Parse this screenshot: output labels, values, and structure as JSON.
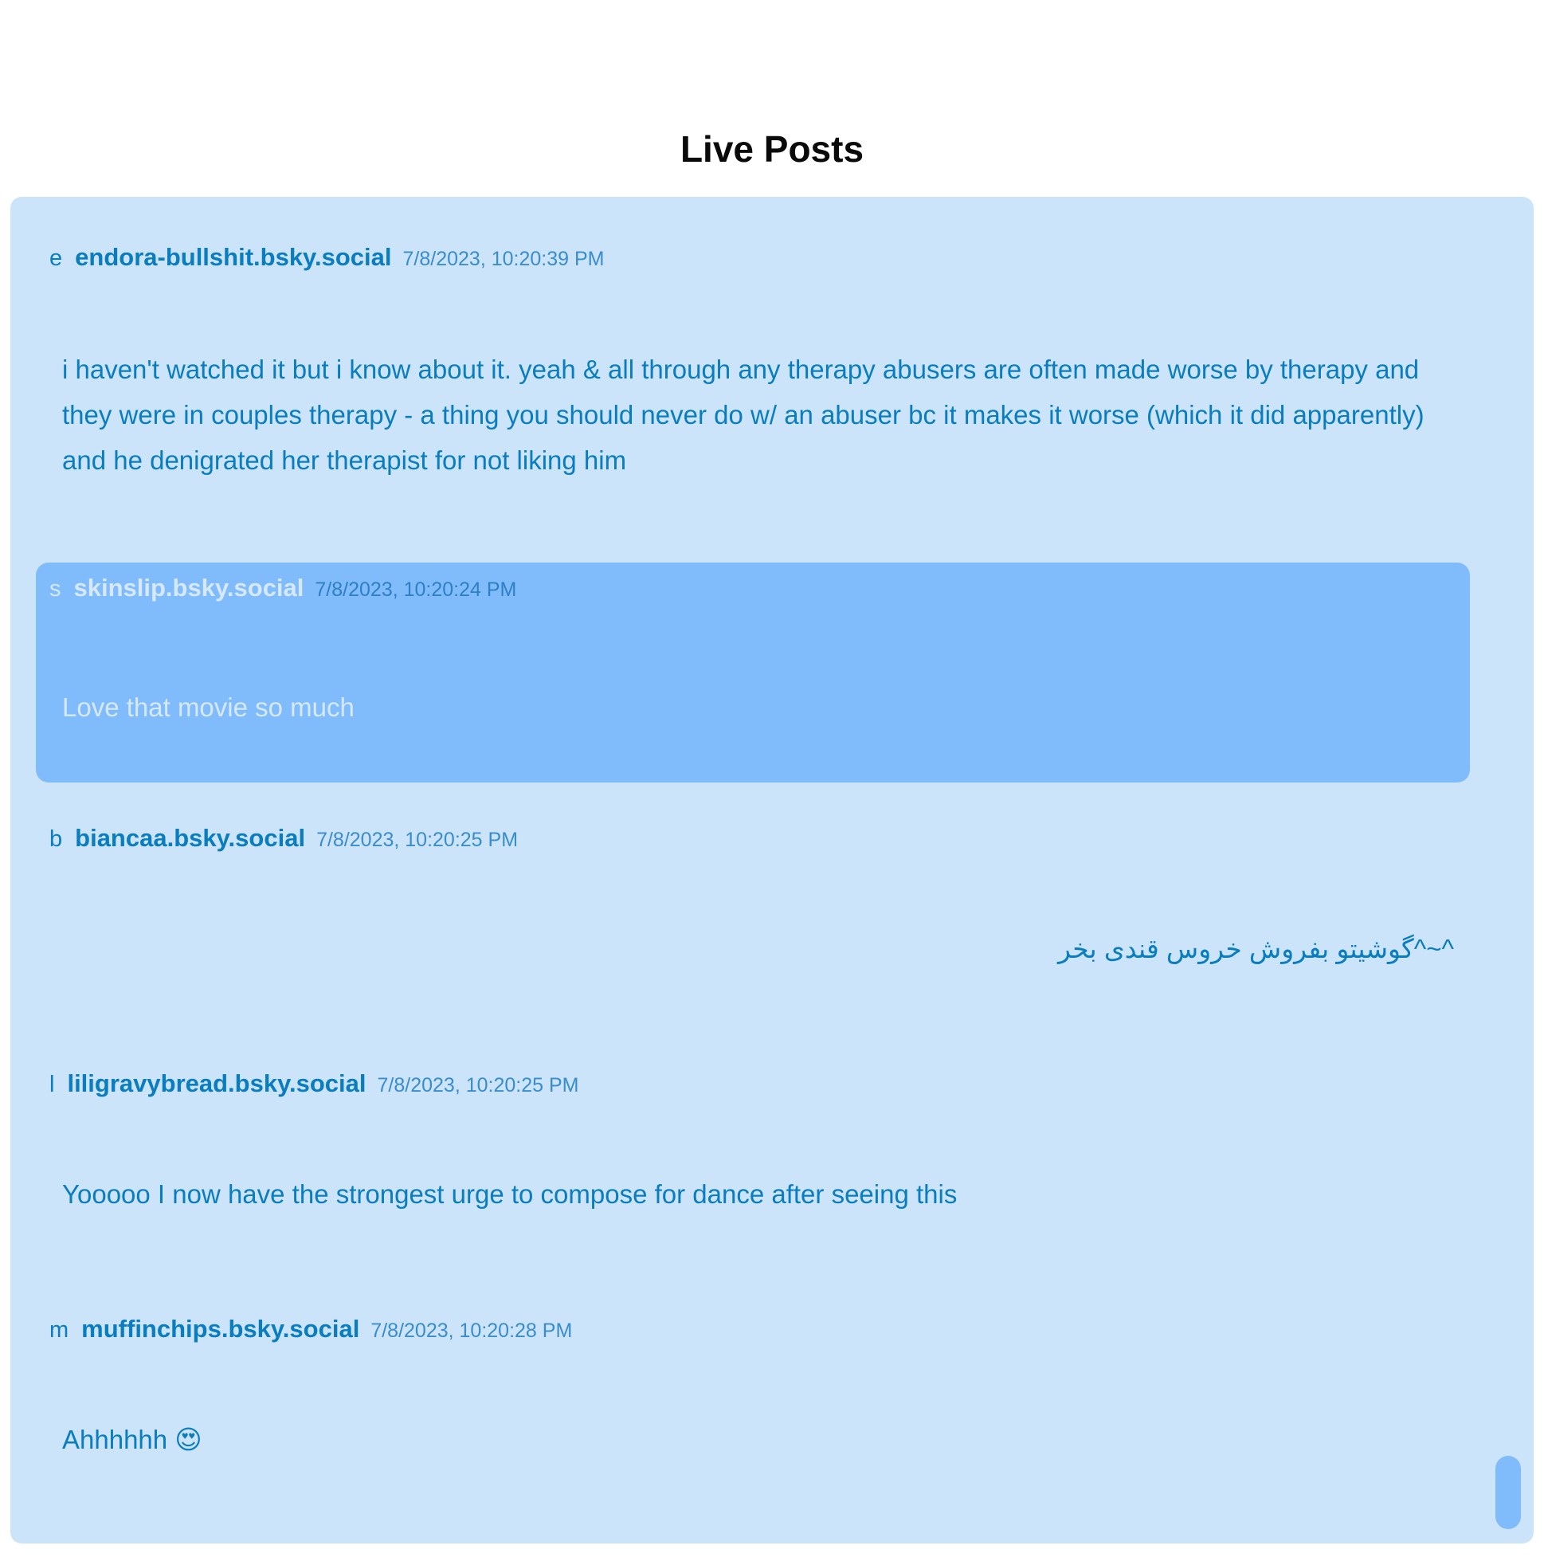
{
  "page": {
    "title": "Live Posts"
  },
  "posts": [
    {
      "avatar_letter": "e",
      "author": "endora-bullshit.bsky.social",
      "timestamp": "7/8/2023, 10:20:39 PM",
      "text": "i haven't watched it but i know about it. yeah & all through any therapy abusers are often made worse by therapy and they were in couples therapy - a thing you should never do w/ an abuser bc it makes it worse (which it did apparently) and he denigrated her therapist for not liking him",
      "highlighted": false
    },
    {
      "avatar_letter": "s",
      "author": "skinslip.bsky.social",
      "timestamp": "7/8/2023, 10:20:24 PM",
      "text": "Love that movie so much",
      "highlighted": true
    },
    {
      "avatar_letter": "b",
      "author": "biancaa.bsky.social",
      "timestamp": "7/8/2023, 10:20:25 PM",
      "text": "^~^گوشیتو بفروش خروس قندی بخر",
      "highlighted": false
    },
    {
      "avatar_letter": "l",
      "author": "liligravybread.bsky.social",
      "timestamp": "7/8/2023, 10:20:25 PM",
      "text": "Yooooo I now have the strongest urge to compose for dance after seeing this",
      "highlighted": false
    },
    {
      "avatar_letter": "m",
      "author": "muffinchips.bsky.social",
      "timestamp": "7/8/2023, 10:20:28 PM",
      "text": "Ahhhhhh 😍",
      "highlighted": false
    }
  ],
  "colors": {
    "feed_background": "#cbe4fa",
    "highlight_background": "#80bcfb",
    "accent_text": "#0a7dbf"
  }
}
